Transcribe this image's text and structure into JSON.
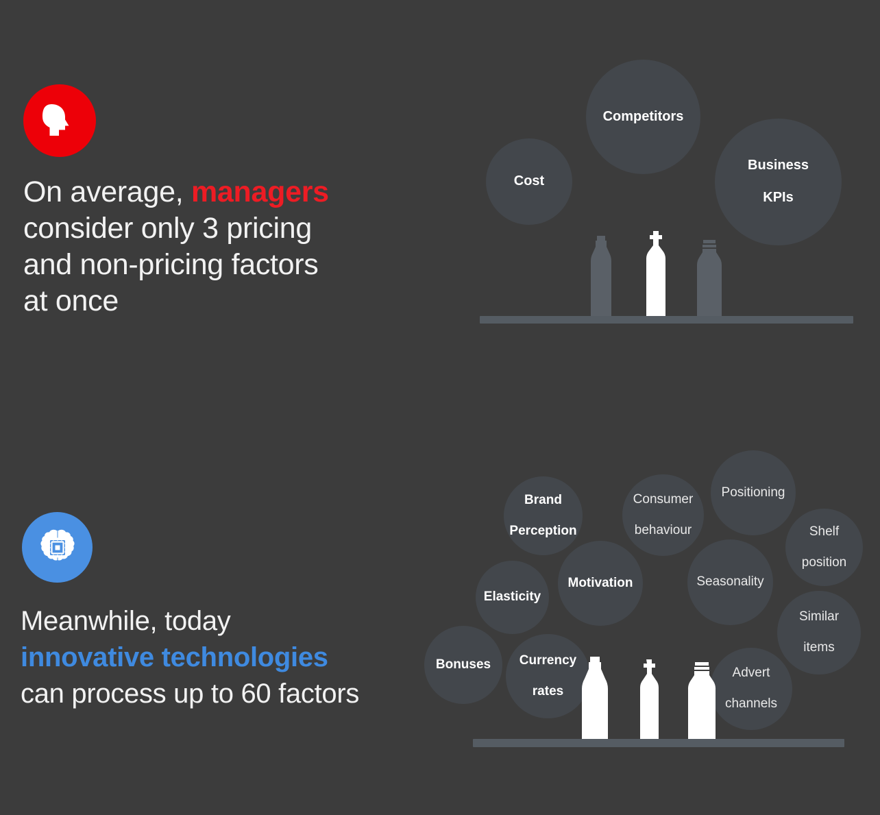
{
  "background_color": "#3c3c3c",
  "bubble_color": "#43474c",
  "shelf_color": "#555c63",
  "sections": [
    {
      "id": "managers",
      "badge": {
        "icon": "head-profile-icon",
        "background": "#ed0008",
        "foreground": "#ffffff"
      },
      "headline": {
        "line1_before": "On average, ",
        "accent": "managers",
        "accent_color": "#ed1c24",
        "line2": "consider only 3 pricing",
        "line3": "and non-pricing factors",
        "line4": "at once"
      },
      "factor_count": 3,
      "bubbles": [
        {
          "label": "Cost",
          "weight": "bold"
        },
        {
          "label": "Competitors",
          "weight": "bold"
        },
        {
          "label": "Business KPIs",
          "weight": "bold"
        }
      ],
      "bottles": [
        {
          "shape": "tall-slim-bottle",
          "fill": "#5a6067"
        },
        {
          "shape": "shoulder-cap-bottle",
          "fill": "#ffffff",
          "highlighted": true
        },
        {
          "shape": "ribbed-neck-jar",
          "fill": "#5a6067"
        }
      ]
    },
    {
      "id": "technologies",
      "badge": {
        "icon": "brain-chip-icon",
        "background": "#4a90e2",
        "foreground": "#ffffff"
      },
      "headline": {
        "line1": "Meanwhile, today",
        "accent": "innovative technologies",
        "accent_color": "#3f8ae0",
        "line3": "can process up to 60 factors"
      },
      "factor_count": 60,
      "bubbles": [
        {
          "label": "Brand Perception",
          "weight": "bold"
        },
        {
          "label": "Consumer behaviour",
          "weight": "regular"
        },
        {
          "label": "Positioning",
          "weight": "regular"
        },
        {
          "label": "Shelf position",
          "weight": "regular"
        },
        {
          "label": "Motivation",
          "weight": "bold"
        },
        {
          "label": "Seasonality",
          "weight": "regular"
        },
        {
          "label": "Elasticity",
          "weight": "bold"
        },
        {
          "label": "Similar items",
          "weight": "regular"
        },
        {
          "label": "Bonuses",
          "weight": "bold"
        },
        {
          "label": "Currency rates",
          "weight": "bold"
        },
        {
          "label": "Advert channels",
          "weight": "regular"
        }
      ],
      "bottles": [
        {
          "shape": "tall-slim-bottle",
          "fill": "#ffffff",
          "highlighted": true
        },
        {
          "shape": "shoulder-cap-bottle",
          "fill": "#ffffff",
          "highlighted": true
        },
        {
          "shape": "ribbed-neck-jar",
          "fill": "#ffffff",
          "highlighted": true
        }
      ]
    }
  ],
  "labels": {
    "top": {
      "cost": "Cost",
      "competitors": "Competitors",
      "business_kpis_line1": "Business",
      "business_kpis_line2": "KPIs"
    },
    "bottom": {
      "brand_perception_line1": "Brand",
      "brand_perception_line2": "Perception",
      "consumer_behaviour_line1": "Consumer",
      "consumer_behaviour_line2": "behaviour",
      "positioning": "Positioning",
      "shelf_position_line1": "Shelf",
      "shelf_position_line2": "position",
      "motivation": "Motivation",
      "seasonality": "Seasonality",
      "elasticity": "Elasticity",
      "similar_items_line1": "Similar",
      "similar_items_line2": "items",
      "bonuses": "Bonuses",
      "currency_rates_line1": "Currency",
      "currency_rates_line2": "rates",
      "advert_channels_line1": "Advert",
      "advert_channels_line2": "channels"
    }
  },
  "headlines": {
    "managers": {
      "part1": "On average, ",
      "accent": "managers",
      "part2": "consider only 3 pricing",
      "part3": "and non-pricing factors",
      "part4": "at once"
    },
    "technologies": {
      "part1": "Meanwhile, today",
      "accent": "innovative technologies",
      "part2": "can process up to 60 factors"
    }
  }
}
